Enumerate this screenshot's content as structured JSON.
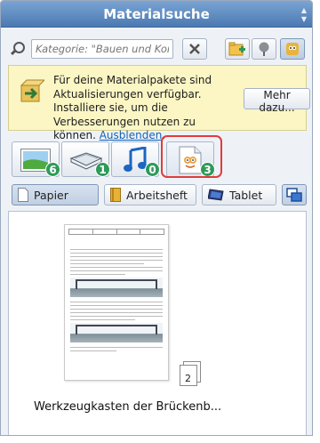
{
  "window": {
    "title": "Materialsuche"
  },
  "search": {
    "placeholder": "Kategorie: \"Bauen und Kons..."
  },
  "notice": {
    "text": "Für deine Materialpakete sind Aktualisierungen verfügbar. Installiere sie, um die Verbesserungen nutzen zu können.",
    "link": "Ausblenden",
    "after_link": ".",
    "button": "Mehr dazu..."
  },
  "media_tabs": [
    {
      "name": "images",
      "count": "6"
    },
    {
      "name": "books",
      "count": "1"
    },
    {
      "name": "audio",
      "count": "0"
    },
    {
      "name": "documents",
      "count": "3",
      "selected": true
    }
  ],
  "format_buttons": {
    "paper": "Papier",
    "workbook": "Arbeitsheft",
    "tablet": "Tablet"
  },
  "result": {
    "title": "Werkzeugkasten der Brückenb...",
    "page_count": "2"
  },
  "colors": {
    "titlebar": "#5b88c2",
    "badge": "#2e9a59",
    "highlight": "#e03c3c",
    "notice_bg": "#fbf6c4"
  }
}
